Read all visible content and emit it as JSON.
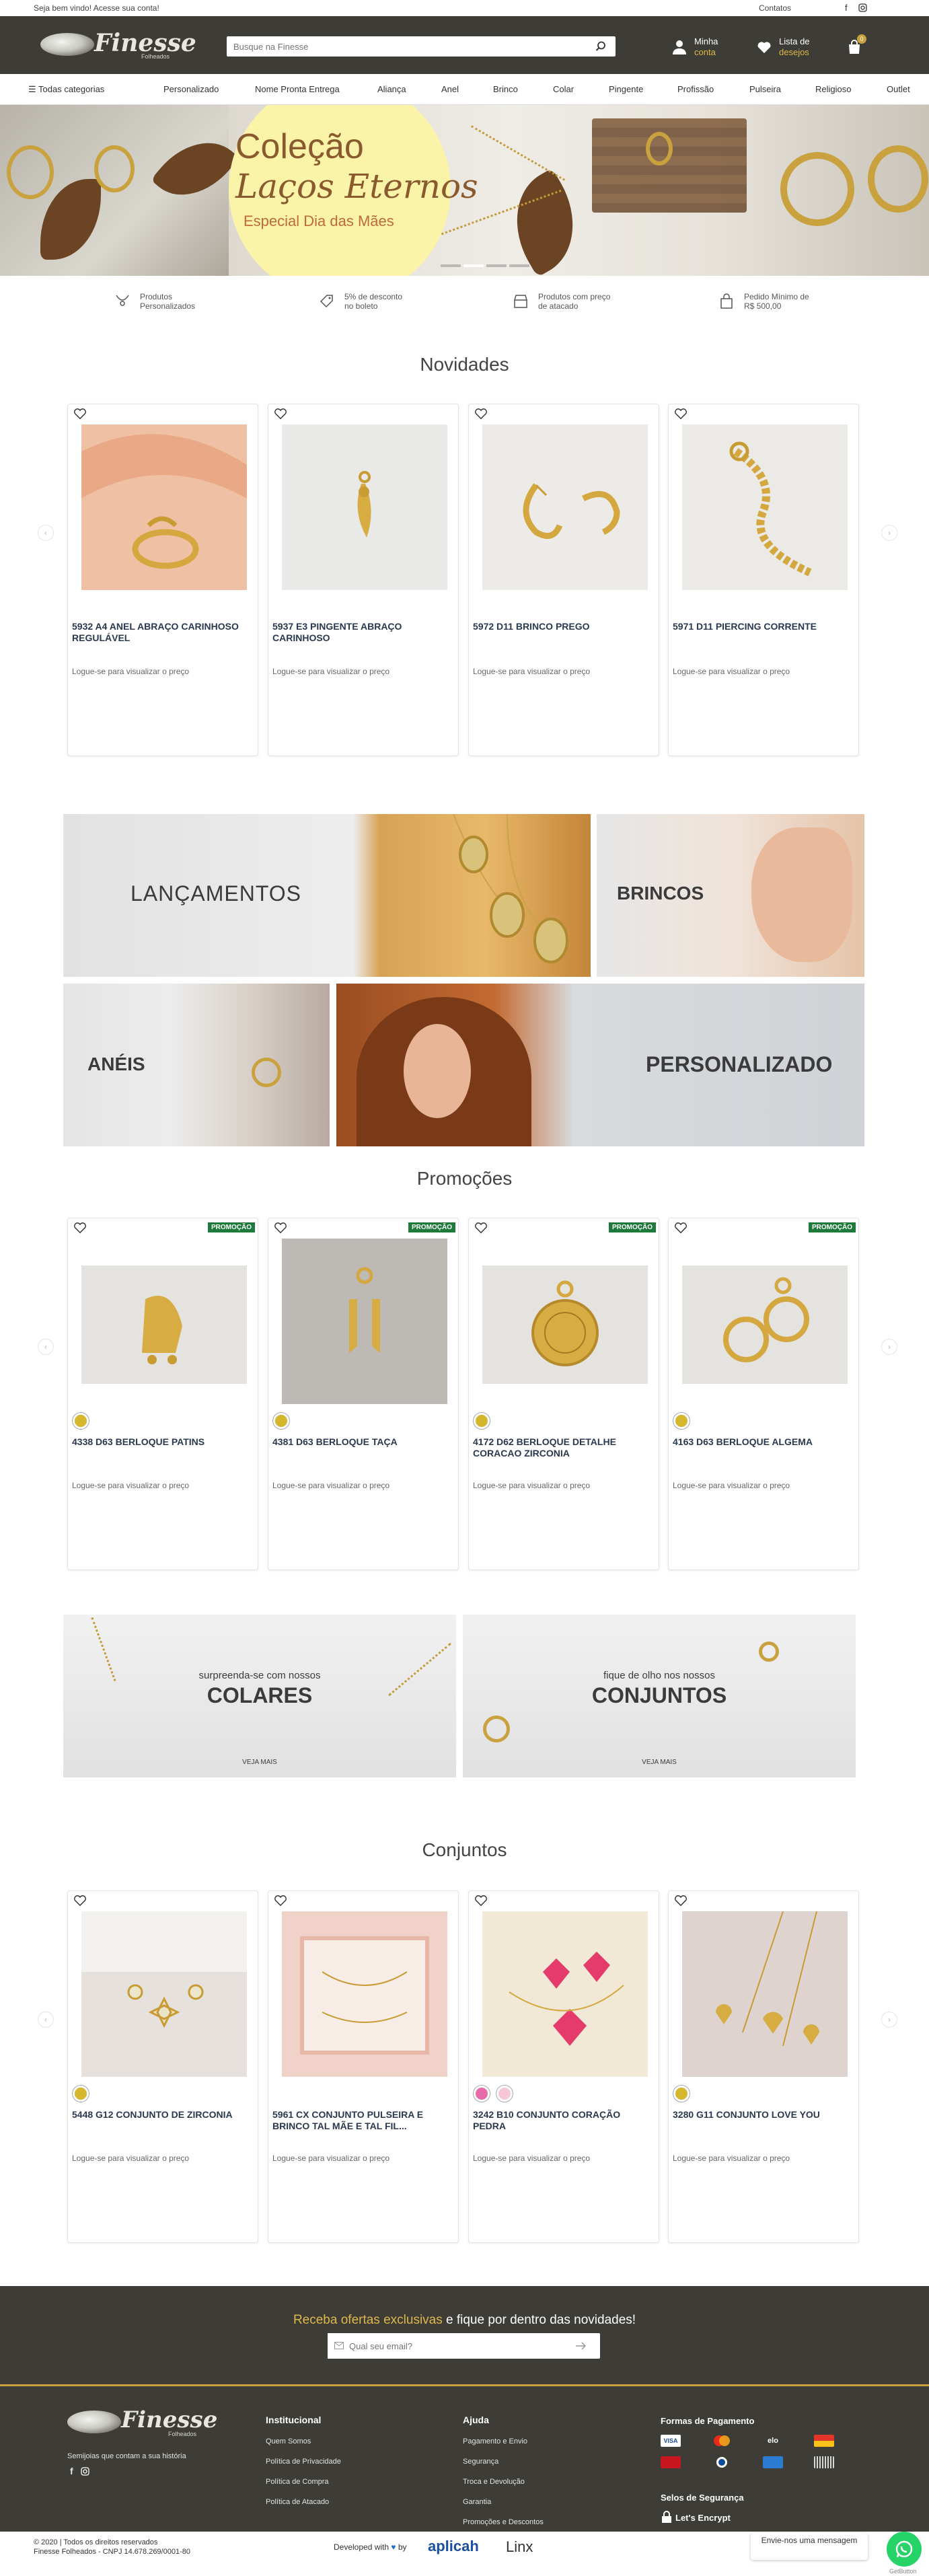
{
  "topbar": {
    "welcome": "Seja bem vindo! Acesse sua conta!",
    "contacts": "Contatos"
  },
  "header": {
    "logo": "Finesse",
    "logo_sub": "Folheados",
    "search_placeholder": "Busque na Finesse",
    "account_l1": "Minha",
    "account_l2": "conta",
    "wishlist_l1": "Lista de",
    "wishlist_l2": "desejos",
    "cart_count": "0"
  },
  "nav": {
    "all": "Todas categorias",
    "items": [
      "Personalizado",
      "Nome Pronta Entrega",
      "Aliança",
      "Anel",
      "Brinco",
      "Colar",
      "Pingente",
      "Profissão",
      "Pulseira",
      "Religioso",
      "Outlet"
    ]
  },
  "hero": {
    "l1": "Coleção",
    "l2": "Laços Eternos",
    "l3": "Especial Dia das Mães"
  },
  "benefits": [
    {
      "l1": "Produtos",
      "l2": "Personalizados"
    },
    {
      "l1": "5% de desconto",
      "l2": "no boleto"
    },
    {
      "l1": "Produtos com preço",
      "l2": "de atacado"
    },
    {
      "l1": "Pedido Mínimo de",
      "l2": "R$ 500,00"
    }
  ],
  "novidades": {
    "title": "Novidades",
    "products": [
      {
        "name": "5932 A4 ANEL ABRAÇO CARINHOSO REGULÁVEL",
        "price": "Logue-se para visualizar o preço"
      },
      {
        "name": "5937 E3 PINGENTE ABRAÇO CARINHOSO",
        "price": "Logue-se para visualizar o preço"
      },
      {
        "name": "5972 D11 BRINCO PREGO",
        "price": "Logue-se para visualizar o preço"
      },
      {
        "name": "5971 D11 PIERCING CORRENTE",
        "price": "Logue-se para visualizar o preço"
      }
    ]
  },
  "categories": {
    "lancamentos": "LANÇAMENTOS",
    "brincos": "BRINCOS",
    "aneis": "ANÉIS",
    "personalizado": "PERSONALIZADO"
  },
  "promocoes": {
    "title": "Promoções",
    "badge": "PROMOÇÃO",
    "products": [
      {
        "name": "4338 D63 BERLOQUE PATINS",
        "price": "Logue-se para visualizar o preço"
      },
      {
        "name": "4381 D63 BERLOQUE TAÇA",
        "price": "Logue-se para visualizar o preço"
      },
      {
        "name": "4172 D62 BERLOQUE DETALHE CORACAO ZIRCONIA",
        "price": "Logue-se para visualizar o preço"
      },
      {
        "name": "4163 D63 BERLOQUE ALGEMA",
        "price": "Logue-se para visualizar o preço"
      }
    ]
  },
  "promo_banners": [
    {
      "sub": "surpreenda-se com nossos",
      "title": "COLARES",
      "cta": "VEJA MAIS"
    },
    {
      "sub": "fique de olho nos nossos",
      "title": "CONJUNTOS",
      "cta": "VEJA MAIS"
    }
  ],
  "conjuntos": {
    "title": "Conjuntos",
    "products": [
      {
        "name": "5448 G12 CONJUNTO DE ZIRCONIA",
        "price": "Logue-se para visualizar o preço"
      },
      {
        "name": "5961 CX CONJUNTO PULSEIRA E BRINCO TAL MÃE E TAL FIL...",
        "price": "Logue-se para visualizar o preço"
      },
      {
        "name": "3242 B10 CONJUNTO CORAÇÃO PEDRA",
        "price": "Logue-se para visualizar o preço"
      },
      {
        "name": "3280 G11 CONJUNTO LOVE YOU",
        "price": "Logue-se para visualizar o preço"
      }
    ]
  },
  "newsletter": {
    "gold": "Receba ofertas exclusivas",
    "rest": " e fique por dentro das novidades!",
    "placeholder": "Qual seu email?"
  },
  "footer": {
    "tagline": "Semijoias que contam a sua história",
    "institucional": {
      "title": "Institucional",
      "links": [
        "Quem Somos",
        "Política de Privacidade",
        "Política de Compra",
        "Política de Atacado"
      ]
    },
    "ajuda": {
      "title": "Ajuda",
      "links": [
        "Pagamento e Envio",
        "Segurança",
        "Troca e Devolução",
        "Garantia",
        "Promoções e Descontos"
      ]
    },
    "pagamento": {
      "title": "Formas de Pagamento"
    },
    "selos": {
      "title": "Selos de Segurança",
      "lets_encrypt": "Let's Encrypt"
    },
    "copyright": "© 2020 | Todos os direitos reservados",
    "company": "Finesse Folheados - CNPJ 14.678.269/0001-80",
    "developed": "Developed with",
    "by": "by",
    "aplicah": "aplicah",
    "linx": "Linx",
    "whatsapp": "Envie-nos uma mensagem",
    "getbutton": "GetButton"
  },
  "colors": {
    "header_bg": "#3d3c36",
    "gold": "#e0b84a",
    "promo_badge": "#1e7a3a",
    "swatch_gold": "#d4b72c",
    "swatch_pink": "#e86aa8",
    "swatch_light_pink": "#f7c6d9"
  }
}
